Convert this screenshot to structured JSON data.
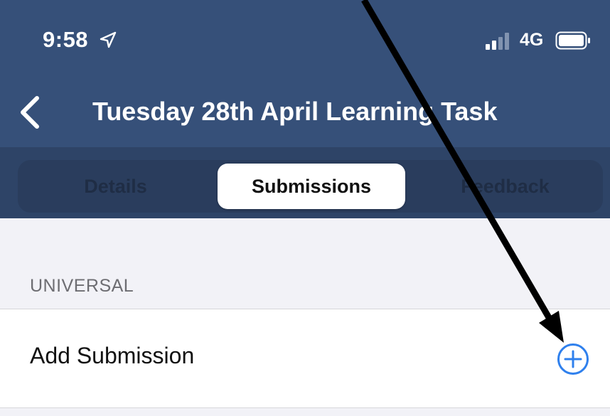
{
  "status_bar": {
    "time": "9:58",
    "network": "4G",
    "location_icon": "location-arrow-icon",
    "signal_icon": "cellular-signal-icon",
    "battery_icon": "battery-icon"
  },
  "nav": {
    "back_icon": "chevron-left-icon",
    "title": "Tuesday 28th April Learning Task"
  },
  "tabs": [
    {
      "label": "Details",
      "selected": false
    },
    {
      "label": "Submissions",
      "selected": true
    },
    {
      "label": "Feedback",
      "selected": false
    }
  ],
  "section": {
    "header": "UNIVERSAL",
    "items": [
      {
        "label": "Add Submission",
        "icon": "add-circle-icon"
      }
    ]
  },
  "colors": {
    "header_background": "#365079",
    "segment_background": "#2e4467",
    "accent": "#2f80ed",
    "annotation_arrow": "#000000"
  }
}
